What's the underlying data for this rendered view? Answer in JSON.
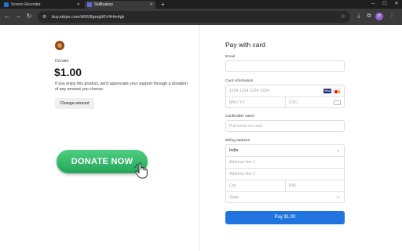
{
  "browser": {
    "tabs": [
      {
        "label": "Screen Recorder",
        "favicon_color": "#2b6fd6"
      },
      {
        "label": "Skillbakery",
        "favicon_color": "#5f6ad6"
      }
    ],
    "new_tab": "+",
    "url": "buy.stripe.com/dR63fgeq|d0V4Hm4gk",
    "profile_initial": "P"
  },
  "donation": {
    "label": "Donate",
    "amount": "$1.00",
    "description": "If you enjoy this product, we'd appreciate your support through a donation of any amount you choose.",
    "change_amount": "Change amount",
    "donate_now": "DONATE NOW"
  },
  "payment": {
    "title": "Pay with card",
    "email_label": "Email",
    "email_value": "",
    "card_label": "Card information",
    "card_number_placeholder": "1234 1234 1234 1234",
    "card_brands": [
      "VISA",
      "Mastercard"
    ],
    "expiry_placeholder": "MM / YY",
    "cvc_placeholder": "CVC",
    "cardholder_label": "Cardholder name",
    "cardholder_placeholder": "Full name on card",
    "billing_label": "Billing address",
    "country": "India",
    "address1_placeholder": "Address line 1",
    "address2_placeholder": "Address line 2",
    "city_placeholder": "City",
    "pin_placeholder": "PIN",
    "state_placeholder": "State",
    "pay_button": "Pay $1.00"
  },
  "colors": {
    "pay_button": "#1f74e0",
    "donate_button": "#2eb865"
  }
}
